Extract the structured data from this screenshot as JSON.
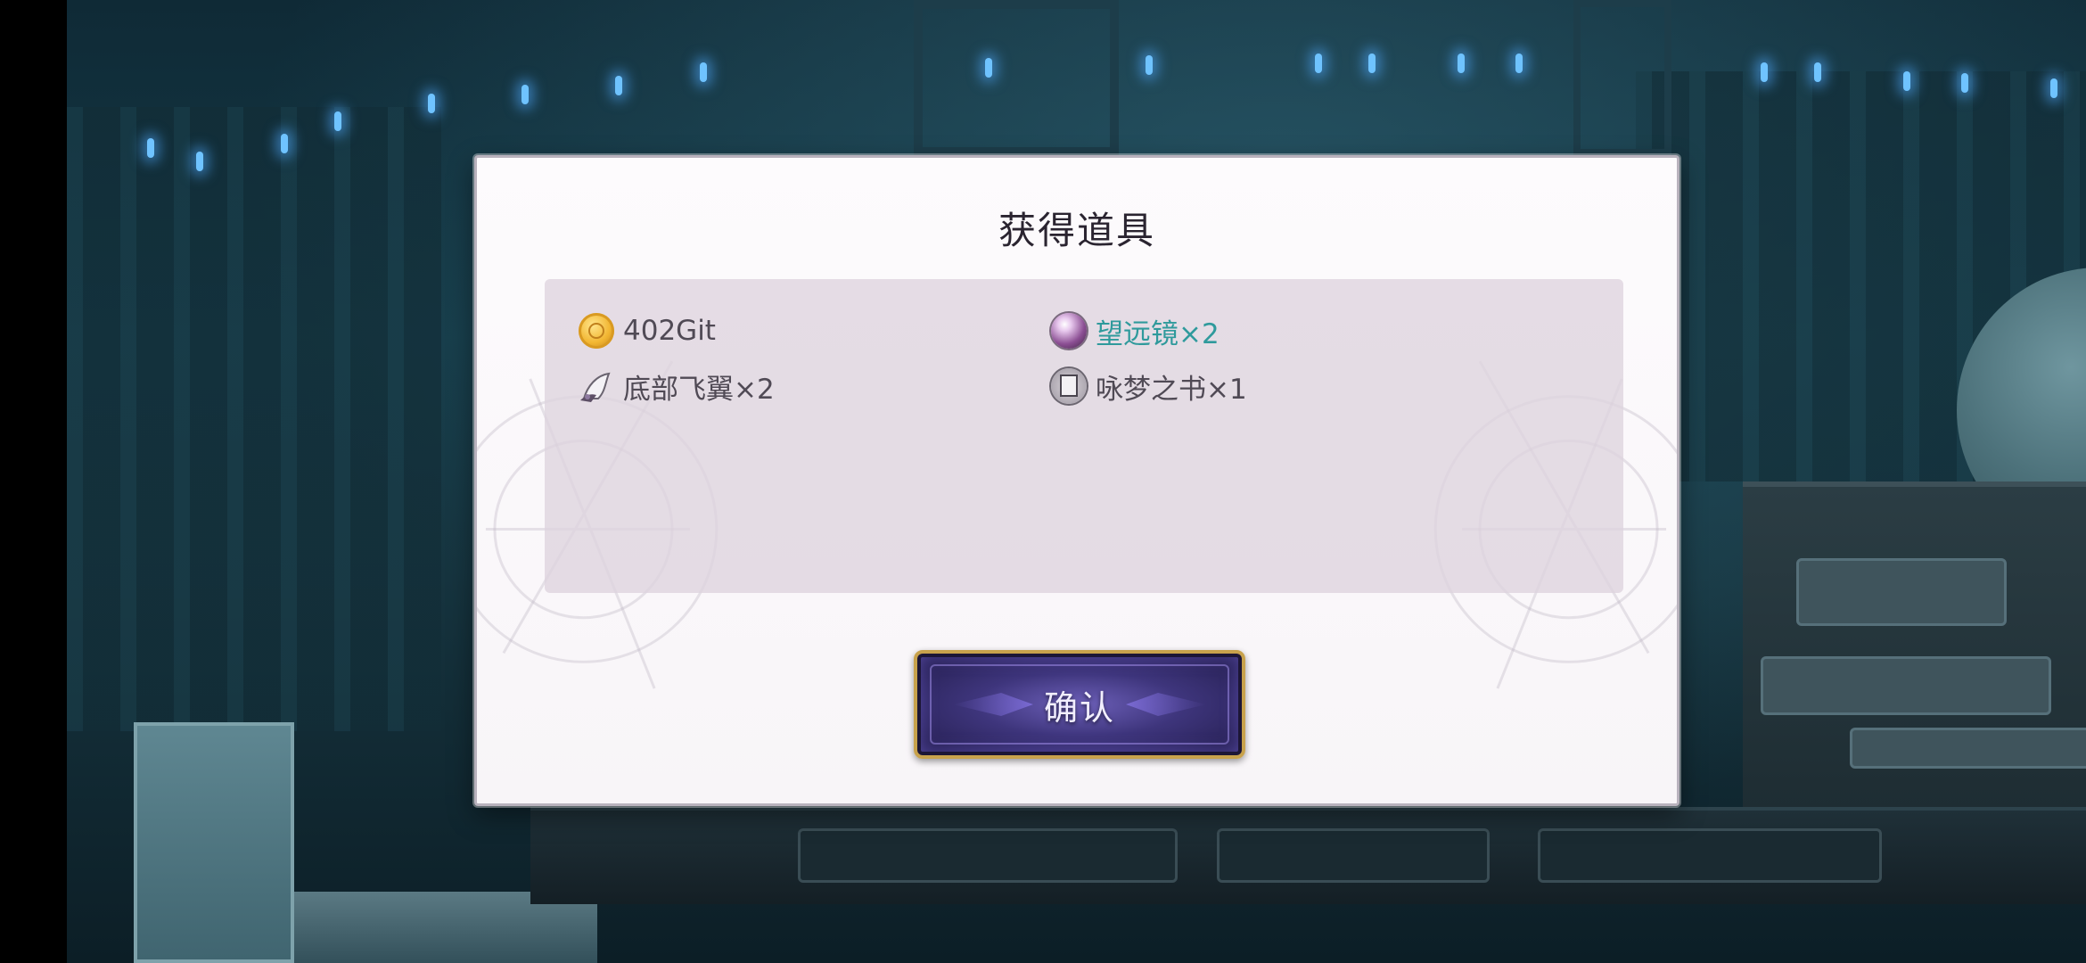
{
  "dialog": {
    "title": "获得道具",
    "items": [
      {
        "icon": "coin-icon",
        "label": "402Git",
        "highlight": false
      },
      {
        "icon": "orb-icon",
        "label": "望远镜×2",
        "highlight": true,
        "highlight_color": "#2f9a9c"
      },
      {
        "icon": "wing-icon",
        "label": "底部飞翼×2",
        "highlight": false
      },
      {
        "icon": "book-icon",
        "label": "咏梦之书×1",
        "highlight": false
      }
    ],
    "confirm_label": "确认"
  },
  "colors": {
    "dialog_bg": "#fdfbfd",
    "panel_bg": "#ded4de",
    "text": "#504a55",
    "highlight_text": "#2f9a9c",
    "button_border": "#c8a24c",
    "button_fill": "#3e357c"
  }
}
